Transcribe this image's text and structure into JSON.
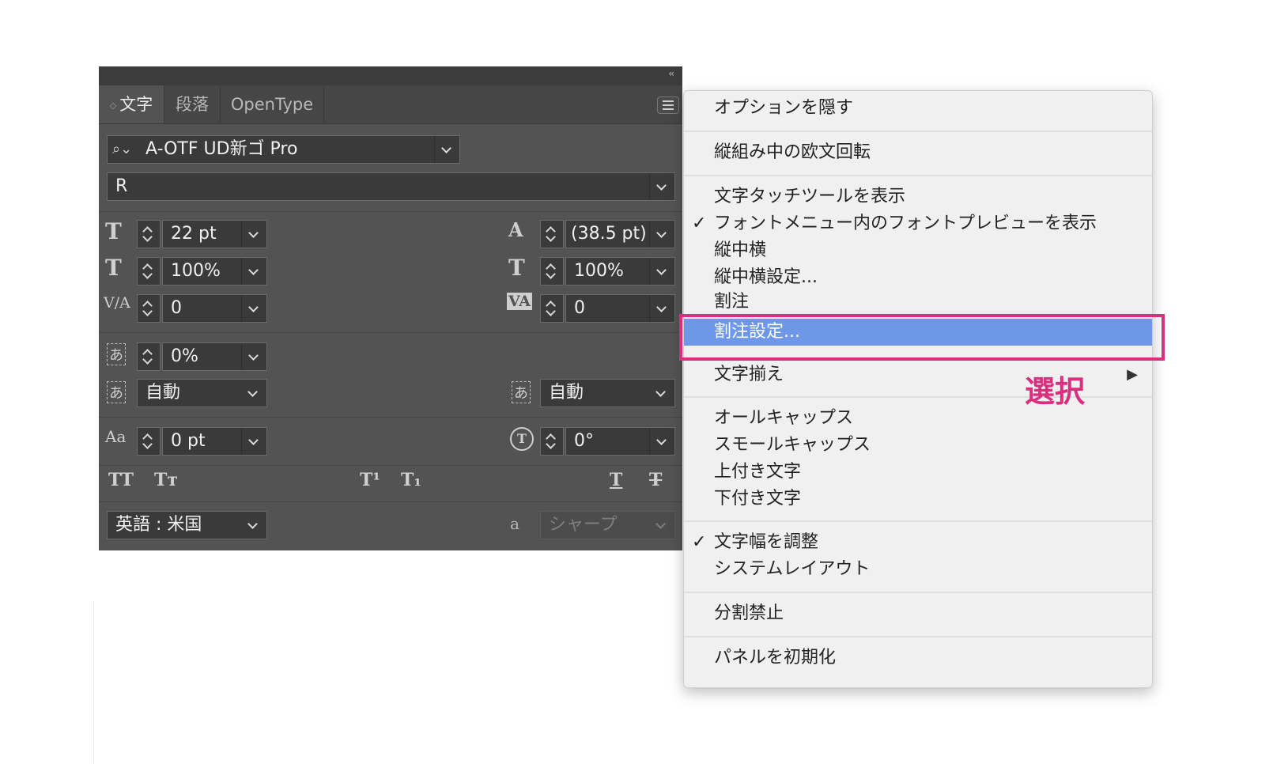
{
  "panel": {
    "collapse": "‹‹",
    "tabs": [
      {
        "label": "文字",
        "active": true
      },
      {
        "label": "段落",
        "active": false
      },
      {
        "label": "OpenType",
        "active": false
      }
    ],
    "font_family": "A-OTF UD新ゴ Pro",
    "font_style": "R",
    "font_size": "22 pt",
    "leading": "(38.5 pt)",
    "vertical_scale": "100%",
    "horizontal_scale": "100%",
    "kerning": "0",
    "tracking": "0",
    "tsume": "0%",
    "aki_left": "自動",
    "aki_right": "自動",
    "baseline_shift": "0 pt",
    "rotation": "0°",
    "language": "英語 : 米国",
    "antialias": "シャープ",
    "icon_glyphs": {
      "size": "T",
      "leading": "A",
      "vscale": "T",
      "hscale": "T",
      "kern": "V/A",
      "track": "VA",
      "tsume": "あ",
      "aki_l": "あ",
      "aki_r": "あ",
      "bshift": "Aa",
      "rotate": "T",
      "aa": "a"
    },
    "style_buttons": [
      "TT",
      "Tт",
      "T¹",
      "T₁",
      "T",
      "T"
    ]
  },
  "menu": {
    "items": [
      {
        "label": "オプションを隠す"
      },
      {
        "label": "縦組み中の欧文回転"
      },
      {
        "label": "文字タッチツールを表示"
      },
      {
        "label": "フォントメニュー内のフォントプレビューを表示",
        "checked": true
      },
      {
        "label": "縦中横"
      },
      {
        "label": "縦中横設定..."
      },
      {
        "label": "割注"
      },
      {
        "label": "割注設定...",
        "highlighted": true
      },
      {
        "label": "文字揃え",
        "submenu": "▶"
      },
      {
        "label": "オールキャップス"
      },
      {
        "label": "スモールキャップス"
      },
      {
        "label": "上付き文字"
      },
      {
        "label": "下付き文字"
      },
      {
        "label": "文字幅を調整",
        "checked": true
      },
      {
        "label": "システムレイアウト"
      },
      {
        "label": "分割禁止"
      },
      {
        "label": "パネルを初期化"
      }
    ],
    "checkmark": "✓"
  },
  "annotation": {
    "label": "選択",
    "color": "#d8307f"
  },
  "colors": {
    "panel_bg": "#535353",
    "highlight": "#6e97e8",
    "accent": "#d8307f"
  }
}
